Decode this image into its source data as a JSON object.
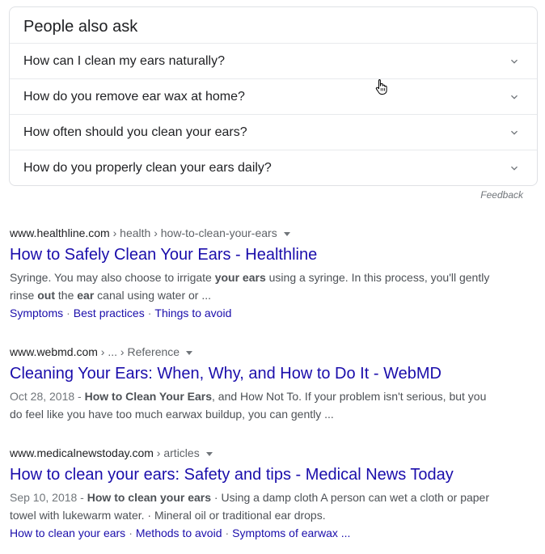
{
  "paa": {
    "title": "People also ask",
    "questions": [
      "How can I clean my ears naturally?",
      "How do you remove ear wax at home?",
      "How often should you clean your ears?",
      "How do you properly clean your ears daily?"
    ],
    "chevron_icon": "chevron-down-icon",
    "feedback": "Feedback"
  },
  "results": [
    {
      "domain": "www.healthline.com",
      "breadcrumb": " › health › how-to-clean-your-ears",
      "title": "How to Safely Clean Your Ears - Healthline",
      "snippet": {
        "line1_a": "Syringe. You may also choose to irrigate ",
        "line1_b": "your ears",
        "line1_c": " using a syringe. In this process, you'll gently",
        "line2_a": "rinse ",
        "line2_b": "out",
        "line2_c": " the ",
        "line2_d": "ear",
        "line2_e": " canal using water or ..."
      },
      "sitelinks": [
        "Symptoms",
        "Best practices",
        "Things to avoid"
      ]
    },
    {
      "domain": "www.webmd.com",
      "breadcrumb": " › ... › Reference",
      "title": "Cleaning Your Ears: When, Why, and How to Do It - WebMD",
      "snippet": {
        "date": "Oct 28, 2018 - ",
        "line1_b": "How to Clean Your Ears",
        "line1_c": ", and How Not To. If your problem isn't serious, but you",
        "line2": "do feel like you have too much earwax buildup, you can gently ..."
      }
    },
    {
      "domain": "www.medicalnewstoday.com",
      "breadcrumb": " › articles",
      "title": "How to clean your ears: Safety and tips - Medical News Today",
      "snippet": {
        "date": "Sep 10, 2018 - ",
        "line1_b": "How to clean your ears",
        "line1_c": " · Using a damp cloth A person can wet a cloth or paper",
        "line2": "towel with lukewarm water. · Mineral oil or traditional ear drops."
      },
      "sitelinks": [
        "How to clean your ears",
        "Methods to avoid",
        "Symptoms of earwax ..."
      ]
    }
  ],
  "colors": {
    "link": "#1a0dab",
    "text": "#202124",
    "snippet": "#4d5156",
    "border": "#dfe1e5"
  }
}
